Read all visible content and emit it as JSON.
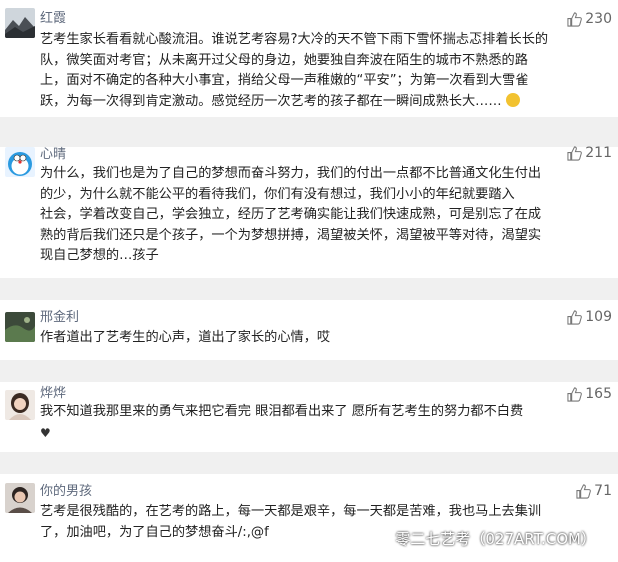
{
  "comments": [
    {
      "username": "红霞",
      "likes": "230",
      "avatar_icon": "landscape-photo",
      "body": "艺考生家长看看就心酸流泪。谁说艺考容易?大冷的天不管下雨下雪怀揣忐忑排着长长的\n队，微笑面对考官；从未离开过父母的身边，她要独自奔波在陌生的城市不熟悉的路\n上，面对不确定的各种大小事宜，捎给父母一声稚嫩的“平安”；为第一次看到大雪雀\n跃，为每一次得到肯定激动。感觉经历一次艺考的孩子都在一瞬间成熟长大……"
    },
    {
      "username": "心晴",
      "likes": "211",
      "avatar_icon": "doraemon-avatar",
      "body": "为什么，我们也是为了自己的梦想而奋斗努力，我们的付出一点都不比普通文化生付出\n的少，为什么就不能公平的看待我们，你们有没有想过，我们小小的年纪就要踏入\n社会，学着改变自己，学会独立，经历了艺考确实能让我们快速成熟，可是别忘了在成\n熟的背后我们还只是个孩子，一个为梦想拼搏，渴望被关怀，渴望被平等对待，渴望实\n现自己梦想的…孩子"
    },
    {
      "username": "邢金利",
      "likes": "109",
      "avatar_icon": "landscape-photo",
      "body": "作者道出了艺考生的心声，道出了家长的心情，哎"
    },
    {
      "username": "烨烨",
      "likes": "165",
      "avatar_icon": "portrait-photo",
      "body": "我不知道我那里来的勇气来把它看完   眼泪都看出来了   愿所有艺考生的努力都不白费"
    },
    {
      "username": "你的男孩",
      "likes": "71",
      "avatar_icon": "portrait-photo",
      "body": "艺考是很残酷的，在艺考的路上，每一天都是艰辛，每一天都是苦难，我也马上去集训\n了，加油吧，为了自己的梦想奋斗/:,@f"
    }
  ],
  "watermark": "零二七艺考（027ART.COM）",
  "colors": {
    "username": "#5f6a7d",
    "separator": "#f0f0f0",
    "body_text": "#222222"
  }
}
